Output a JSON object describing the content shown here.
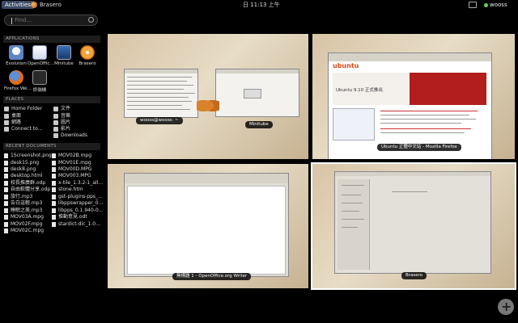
{
  "top_panel": {
    "activities": "Activities",
    "app_name": "Brasero",
    "clock": "日 11:13 上午",
    "user": "wooss"
  },
  "search": {
    "placeholder": "Find..."
  },
  "applications": {
    "heading": "APPLICATIONS",
    "items": [
      {
        "label": "Evolution",
        "icon": "evolution-icon"
      },
      {
        "label": "OpenOffic…",
        "icon": "openoffice-icon"
      },
      {
        "label": "Minitube",
        "icon": "minitube-icon"
      },
      {
        "label": "Brasero",
        "icon": "brasero-icon"
      },
      {
        "label": "Firefox We…",
        "icon": "firefox-icon"
      },
      {
        "label": "終端機",
        "icon": "terminal-icon"
      }
    ]
  },
  "places": {
    "heading": "PLACES",
    "left": [
      "Home Folder",
      "桌面",
      "網路",
      "Connect to…"
    ],
    "right": [
      "文件",
      "音樂",
      "圖片",
      "影片",
      "Downloads"
    ]
  },
  "recent_documents": {
    "heading": "RECENT DOCUMENTS",
    "left": [
      "1Screenshot.png",
      "desk15.png",
      "desk8.png",
      "desktop.html",
      "校長推廣群.odp",
      "自由軟體分享.odp",
      "旅行.mp3",
      "告白這輕.mp3",
      "睡眠之美.mp3",
      "MOV03A.mpg",
      "MOV02F.mpg",
      "MOV02C.mpg"
    ],
    "right": [
      "MOV02B.mpg",
      "MOV01E.mpg",
      "MOV00D.MPG",
      "MOV003.MPG",
      "x-tile_1.3.2-1_all…",
      "stone.htm",
      "gst-plugins-pps_…",
      "libppswrapper_0…",
      "libpps_0.1.940-0…",
      "推動意見.odt",
      "stardict-dic_1.0…"
    ]
  },
  "workspaces": [
    {
      "captions": [
        "wooss@wooss: ~",
        "Minitube"
      ]
    },
    {
      "captions": [
        "Ubuntu 正體中文站 - Mozilla Firefox"
      ],
      "site_logo": "ubuntu",
      "headline": "Ubuntu 9.10 正式推出"
    },
    {
      "captions": [
        "無標題 1 - OpenOffice.org Writer"
      ]
    },
    {
      "captions": [
        "Brasero"
      ]
    }
  ],
  "colors": {
    "accent": "#3b4a66",
    "ubuntu_orange": "#dd4814",
    "ubuntu_red": "#b21d1d"
  }
}
